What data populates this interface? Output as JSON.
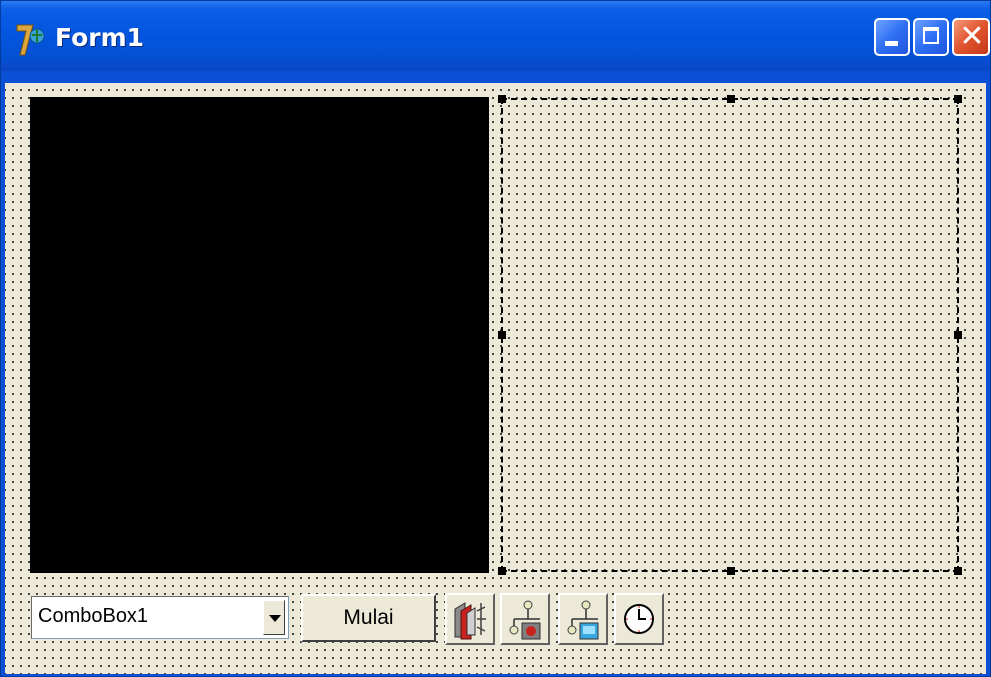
{
  "window": {
    "title": "Form1",
    "buttons": {
      "minimize_icon": "minimize-icon",
      "maximize_icon": "maximize-icon",
      "close_icon": "close-icon"
    }
  },
  "form": {
    "combobox": {
      "value": "ComboBox1",
      "arrow_icon": "chevron-down-icon"
    },
    "start_button": {
      "label": "Mulai"
    },
    "nonvisual_components": [
      {
        "icon": "media-player-component-icon"
      },
      {
        "icon": "server-socket-component-icon"
      },
      {
        "icon": "client-socket-component-icon"
      },
      {
        "icon": "timer-clock-icon"
      }
    ]
  },
  "colors": {
    "titlebar": "#0356e0",
    "client_bg": "#ece9d8",
    "panel": "#000000",
    "close_button": "#e0542e"
  }
}
